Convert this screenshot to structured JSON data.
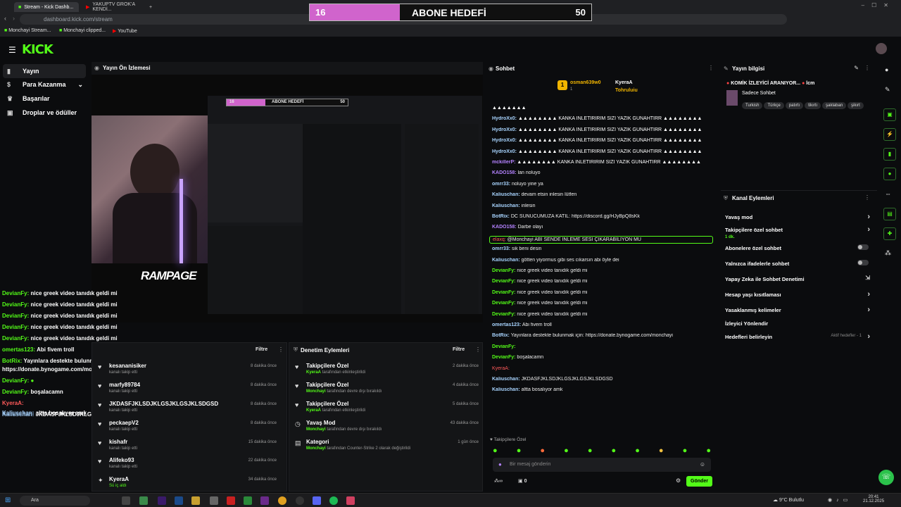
{
  "browser": {
    "tabs": [
      "Stream - Kick Dashb...",
      "YAKUPTV GROK'A KENDİ..."
    ],
    "url": "dashboard.kick.com/stream",
    "bookmarks": [
      "Monchayi Stream...",
      "Monchayi clipped...",
      "YouTube"
    ]
  },
  "goal": {
    "left": "16",
    "title": "ABONE HEDEFİ",
    "right": "50",
    "fill_color": "#d064cc",
    "progress": 0.32
  },
  "kick": {
    "logo": "KICK"
  },
  "sidebar": {
    "items": [
      {
        "label": "Yayın",
        "icon": "broadcast-icon"
      },
      {
        "label": "Para Kazanma",
        "icon": "money-icon"
      },
      {
        "label": "Başarılar",
        "icon": "trophy-icon"
      },
      {
        "label": "Droplar ve ödüller",
        "icon": "gift-icon"
      }
    ]
  },
  "preview": {
    "title": "Yayın Ön İzlemesi",
    "inner_goal_left": "16",
    "inner_goal_title": "ABONE HEDEFİ",
    "inner_goal_right": "50",
    "rampage": "RAMPAGE"
  },
  "overlay_chat": [
    {
      "user": "DevianFy:",
      "text": "nice greek video tanıdık geldi mi"
    },
    {
      "user": "DevianFy:",
      "text": "nice greek video tanıdık geldi mi"
    },
    {
      "user": "DevianFy:",
      "text": "nice greek video tanıdık geldi mi"
    },
    {
      "user": "DevianFy:",
      "text": "nice greek video tanıdık geldi mi"
    },
    {
      "user": "DevianFy:",
      "text": "nice greek video tanıdık geldi mi"
    },
    {
      "user": "omertas123:",
      "text": "Abi fivem troll"
    },
    {
      "user": "BotRix:",
      "text": "Yayınlara destekte bulunmak için:"
    },
    {
      "user": "",
      "text": "https://donate.bynogame.com/monchayi"
    },
    {
      "user": "DevianFy:",
      "text": ""
    },
    {
      "user": "DevianFy:",
      "text": "boşalacamn"
    },
    {
      "user": "KyeraA:",
      "text": ""
    },
    {
      "user": "Kaliuschan:",
      "text": "JKDASFJKLSDJKLGSJKLGSJKLSDGSD"
    },
    {
      "user": "Kaliuschan:",
      "text": "altta bosalıyor amk"
    }
  ],
  "activity": {
    "filter": "Filtre",
    "rows": [
      {
        "name": "kesananisiker",
        "sub": "kanalı takip etti",
        "time": "8 dakika önce"
      },
      {
        "name": "marfy89784",
        "sub": "kanalı takip etti",
        "time": "8 dakika önce"
      },
      {
        "name": "JKDASFJKLSDJKLGSJKLGSJKLSDGSD",
        "sub": "kanalı takip etti",
        "time": "8 dakika önce"
      },
      {
        "name": "peckaepV2",
        "sub": "kanalı takip etti",
        "time": "8 dakika önce"
      },
      {
        "name": "kishafr",
        "sub": "kanalı takip etti",
        "time": "15 dakika önce"
      },
      {
        "name": "Alifeko93",
        "sub": "kanalı takip etti",
        "time": "22 dakika önce"
      },
      {
        "name": "KyeraA",
        "sub": "Sü iç aldı",
        "time": "34 dakika önce"
      }
    ]
  },
  "moderation": {
    "title": "Denetim Eylemleri",
    "filter": "Filtre",
    "rows": [
      {
        "name": "Takipçilere Özel",
        "actor": "KyeraA",
        "sub": "tarafından etkinleştirildi",
        "time": "2 dakika önce"
      },
      {
        "name": "Takipçilere Özel",
        "actor": "Monchayi",
        "sub": "tarafından devre dışı bırakıldı",
        "time": "4 dakika önce"
      },
      {
        "name": "Takipçilere Özel",
        "actor": "KyeraA",
        "sub": "tarafından etkinleştirildi",
        "time": "5 dakika önce"
      },
      {
        "name": "Yavaş Mod",
        "actor": "Monchayi",
        "sub": "tarafından devre dışı bırakıldı",
        "time": "43 dakika önce"
      },
      {
        "name": "Kategori",
        "actor": "Monchayi",
        "sub": "tarafından Counter-Strike 2 olarak değiştirildi",
        "time": "1 gün önce"
      }
    ]
  },
  "chat": {
    "title": "Sohbet",
    "pinned": [
      {
        "name": "osman639w0",
        "count": "1"
      },
      {
        "name": "KyeraA",
        "count": "1"
      },
      {
        "name": "Tohruluiu",
        "count": "1"
      }
    ],
    "messages": [
      {
        "user": "",
        "text": "▲▲▲▲▲▲▲",
        "color": "r"
      },
      {
        "user": "HydroXx0:",
        "text": "▲▲▲▲▲▲▲▲ KANKA İNLETİRİRİM SİZİ YAZIK GUNAHTIRR ▲▲▲▲▲▲▲▲",
        "color": "u"
      },
      {
        "user": "HydroXx0:",
        "text": "▲▲▲▲▲▲▲▲ KANKA İNLETİRİRİM SİZİ YAZIK GUNAHTIRR ▲▲▲▲▲▲▲▲",
        "color": "u"
      },
      {
        "user": "HydroXx0:",
        "text": "▲▲▲▲▲▲▲▲ KANKA İNLETİRİRİM SİZİ YAZIK GUNAHTIRR ▲▲▲▲▲▲▲▲",
        "color": "u"
      },
      {
        "user": "HydroXx0:",
        "text": "▲▲▲▲▲▲▲▲ KANKA İNLETİRİRİM SİZİ YAZIK GUNAHTIRR ▲▲▲▲▲▲▲▲",
        "color": "u"
      },
      {
        "user": "mckillerP:",
        "text": "▲▲▲▲▲▲▲▲ KANKA İNLETİRİRİM SİZİ YAZIK GUNAHTIRR ▲▲▲▲▲▲▲▲",
        "color": "p"
      },
      {
        "user": "KADO158:",
        "text": "lan noluyo",
        "color": "p"
      },
      {
        "user": "omrr33:",
        "text": "noluyo yine ya",
        "color": "u"
      },
      {
        "user": "Kaliuschan:",
        "text": "devam etsin inlesin lütfen",
        "color": "u"
      },
      {
        "user": "Kaliuschan:",
        "text": "inlesin",
        "color": "u"
      },
      {
        "user": "BotRix:",
        "text": "DC SUNUCUMUZA KATIL: https://discord.gg/HJyBpQ8sKk",
        "color": "u"
      },
      {
        "user": "KADO158:",
        "text": "Darbe olayı",
        "color": "p"
      },
      {
        "user": "elaxq:",
        "text": "@Monchayi ABİ SENDE İNLEME SESİ ÇIKARABİLİYON MU",
        "color": "r"
      },
      {
        "user": "omrr33:",
        "text": "sik beni desin",
        "color": "u"
      },
      {
        "user": "Kaliuschan:",
        "text": "götten yiyormus gibi ses cıkarsın abi öyle dei",
        "color": "u"
      },
      {
        "user": "DevianFy:",
        "text": "nice greek video tanıdık geldi mi",
        "color": "g"
      },
      {
        "user": "DevianFy:",
        "text": "nice greek video tanıdık geldi mi",
        "color": "g"
      },
      {
        "user": "DevianFy:",
        "text": "nice greek video tanıdık geldi mi",
        "color": "g"
      },
      {
        "user": "DevianFy:",
        "text": "nice greek video tanıdık geldi mi",
        "color": "g"
      },
      {
        "user": "DevianFy:",
        "text": "nice greek video tanıdık geldi mi",
        "color": "g"
      },
      {
        "user": "omertas123:",
        "text": "Abi fivem troll",
        "color": "u"
      },
      {
        "user": "BotRix:",
        "text": "Yayınlara destekte bulunmak için: https://donate.bynogame.com/monchayi",
        "color": "u"
      },
      {
        "user": "DevianFy:",
        "text": "",
        "color": "g"
      },
      {
        "user": "DevianFy:",
        "text": "boşalacamn",
        "color": "g"
      },
      {
        "user": "KyeraA:",
        "text": "",
        "color": "r"
      },
      {
        "user": "Kaliuschan:",
        "text": "JKDASFJKLSDJKLGSJKLGSJKLSDGSD",
        "color": "u"
      },
      {
        "user": "Kaliuschan:",
        "text": "altta bosalıyor amk",
        "color": "u"
      }
    ],
    "mode_label": "Takipçilere Özel",
    "input_placeholder": "Bir mesaj gönderin",
    "counter_left": "0",
    "send": "Gönder"
  },
  "stream_info": {
    "title": "Yayın bilgisi",
    "stream_title": "KOMİK İZLEYİCİ ARANIYOR...",
    "title_suffix": "lcm",
    "category": "Sadece Sohbet",
    "tags": [
      "Turkish",
      "Türkçe",
      "patırtı",
      "tikırtı",
      "şaklaban",
      "şikırt"
    ]
  },
  "channel_actions": {
    "title": "Kanal Eylemleri",
    "items": [
      {
        "label": "Yavaş mod",
        "type": "arrow"
      },
      {
        "label": "Takipçilere özel sohbet",
        "sub": "1 dk.",
        "type": "arrow"
      },
      {
        "label": "Abonelere özel sohbet",
        "type": "toggle"
      },
      {
        "label": "Yalnızca ifadelerle sohbet",
        "type": "toggle"
      },
      {
        "label": "Yapay Zeka ile Sohbet Denetimi",
        "type": "link"
      },
      {
        "label": "Hesap yaşı kısıtlaması",
        "type": "arrow"
      },
      {
        "label": "Yasaklanmış kelimeler",
        "type": "arrow"
      },
      {
        "label": "İzleyici Yönlendir",
        "type": "none"
      },
      {
        "label": "Hedefleri belirleyin",
        "sub2": "Aktif hedefler - 1",
        "type": "arrow"
      }
    ]
  },
  "taskbar": {
    "search": "Ara",
    "weather": "9°C Bulutlu",
    "time": "20:41",
    "date": "21.12.2025"
  }
}
